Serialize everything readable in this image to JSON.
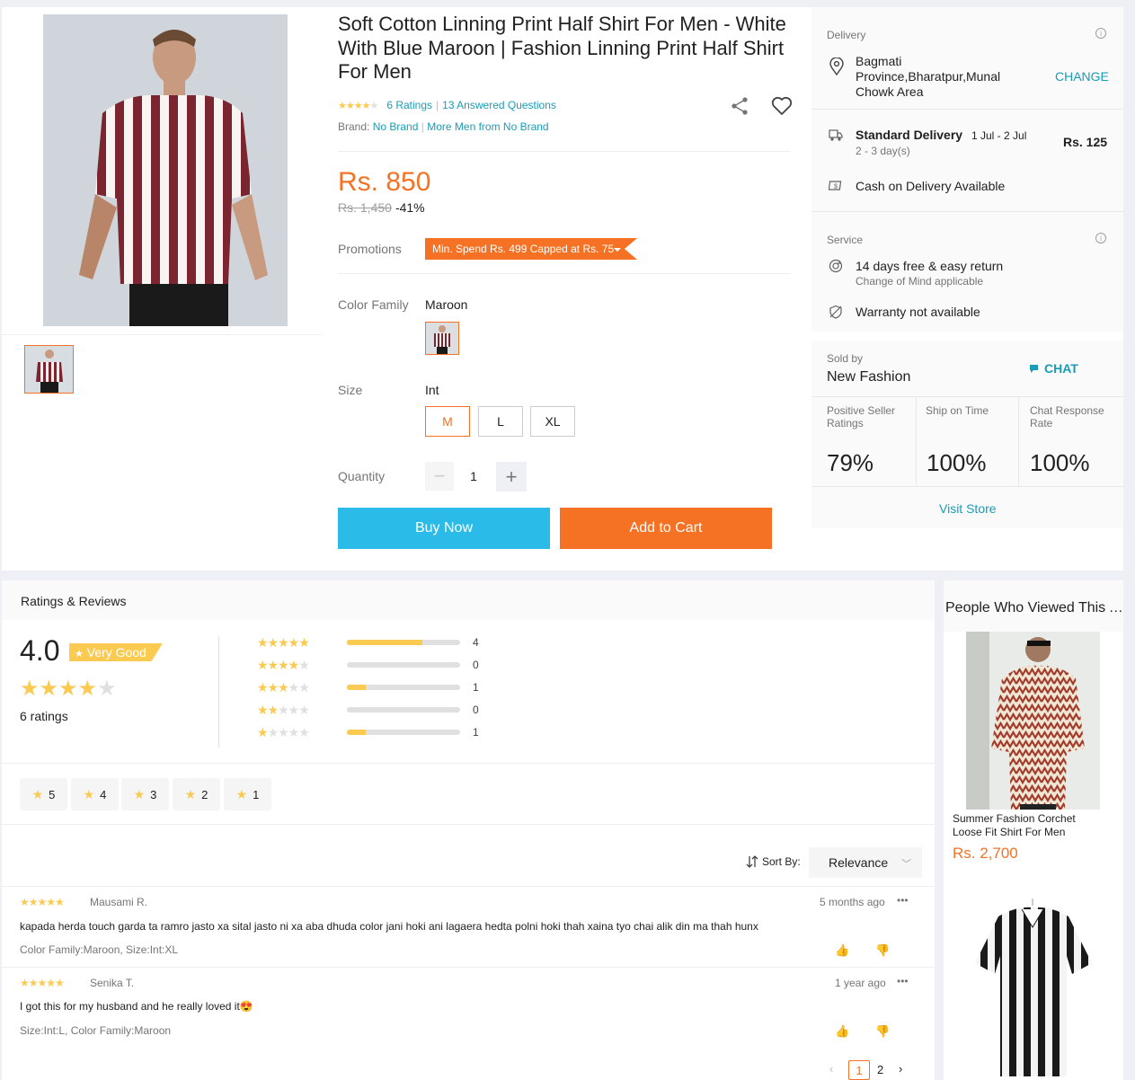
{
  "product": {
    "title": "Soft Cotton Linning Print Half Shirt For Men - White With Blue Maroon | Fashion Linning Print Half Shirt For Men",
    "rating_stars": 4,
    "ratings_link": "6 Ratings",
    "separator": "|",
    "questions_link": "13 Answered Questions",
    "brand_label": "Brand:",
    "brand_value": "No Brand",
    "more_from": "More Men from No Brand",
    "price": "Rs. 850",
    "old_price": "Rs. 1,450",
    "discount": "-41%",
    "promotions_label": "Promotions",
    "promotion_tag": "Min. Spend Rs. 499 Capped at Rs. 75",
    "color_family_label": "Color Family",
    "color_family_value": "Maroon",
    "size_label": "Size",
    "size_system": "Int",
    "sizes": [
      "M",
      "L",
      "XL"
    ],
    "selected_size": "M",
    "quantity_label": "Quantity",
    "quantity": "1",
    "buy_now": "Buy Now",
    "add_to_cart": "Add to Cart"
  },
  "delivery": {
    "label": "Delivery",
    "location": "Bagmati Province,Bharatpur,Munal Chowk Area",
    "change": "CHANGE",
    "standard_title": "Standard Delivery",
    "standard_dates": "1 Jul - 2 Jul",
    "standard_days": "2 - 3 day(s)",
    "standard_price": "Rs. 125",
    "cod": "Cash on Delivery Available"
  },
  "service": {
    "label": "Service",
    "return_title": "14 days free & easy return",
    "return_sub": "Change of Mind applicable",
    "warranty": "Warranty not available"
  },
  "seller": {
    "sold_by_label": "Sold by",
    "name": "New Fashion",
    "chat": "CHAT",
    "stats": [
      {
        "label": "Positive Seller Ratings",
        "value": "79%"
      },
      {
        "label": "Ship on Time",
        "value": "100%"
      },
      {
        "label": "Chat Response Rate",
        "value": "100%"
      }
    ],
    "visit_store": "Visit Store"
  },
  "reviews": {
    "heading": "Ratings & Reviews",
    "score": "4.0",
    "badge": "Very Good",
    "count_text": "6 ratings",
    "breakdown": [
      {
        "stars": 5,
        "count": "4",
        "fraction": 0.67
      },
      {
        "stars": 4,
        "count": "0",
        "fraction": 0
      },
      {
        "stars": 3,
        "count": "1",
        "fraction": 0.17
      },
      {
        "stars": 2,
        "count": "0",
        "fraction": 0
      },
      {
        "stars": 1,
        "count": "1",
        "fraction": 0.17
      }
    ],
    "filters": [
      "5",
      "4",
      "3",
      "2",
      "1"
    ],
    "sort_label": "Sort By:",
    "sort_value": "Relevance",
    "items": [
      {
        "stars": 5,
        "author": "Mausami R.",
        "time": "5 months ago",
        "text": "kapada herda touch garda ta ramro jasto xa sital jasto ni xa aba dhuda color jani hoki ani lagaera hedta polni hoki thah xaina tyo chai alik din ma thah hunx",
        "variant": "Color Family:Maroon, Size:Int:XL"
      },
      {
        "stars": 5,
        "author": "Senika T.",
        "time": "1 year ago",
        "text": "I got this for my husband and he really loved it😍",
        "variant": "Size:Int:L, Color Family:Maroon"
      }
    ],
    "pages": [
      "1",
      "2"
    ],
    "current_page": "1"
  },
  "people_viewed": {
    "title": "People Who Viewed This Also Viewed",
    "items": [
      {
        "name": "Summer Fashion Corchet Loose Fit Shirt For Men",
        "price": "Rs. 2,700"
      }
    ]
  },
  "colors": {
    "accent": "#f57224",
    "link": "#1a9cb7",
    "buy": "#2abbe8",
    "star": "#faca51"
  }
}
